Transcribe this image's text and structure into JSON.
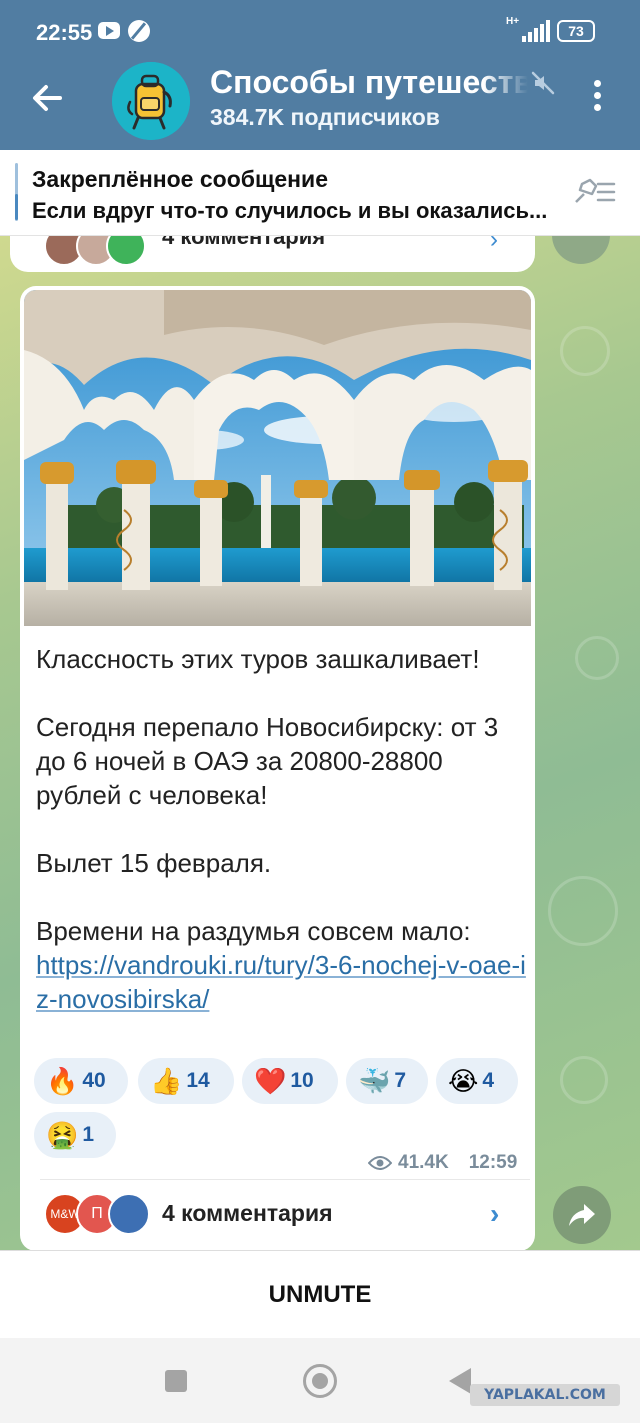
{
  "status_bar": {
    "time": "22:55",
    "network": "H+",
    "battery": "73"
  },
  "header": {
    "channel_title": "Способы путешествовать",
    "subscribers": "384.7K подписчиков",
    "muted": true,
    "colors": {
      "header_bg": "#517da2",
      "avatar_bg": "#1cb4c8"
    }
  },
  "pinned": {
    "title": "Закреплённое сообщение",
    "text": "Если вдруг что-то случилось и вы оказались..."
  },
  "previous_message": {
    "comments_label": "4 комментария"
  },
  "post": {
    "paragraphs": [
      "Классность этих туров зашкаливает!",
      "Сегодня перепало Новосибирску: от 3 до 6 ночей в ОАЭ за 20800-28800 рублей с человека!",
      "Вылет 15 февраля."
    ],
    "last_paragraph": "Времени на раздумья совсем мало:",
    "link": "https://vandrouki.ru/tury/3-6-nochej-v-oae-iz-novosibirska/",
    "reactions": [
      {
        "emoji": "🔥",
        "count": "40"
      },
      {
        "emoji": "👍",
        "count": "14"
      },
      {
        "emoji": "❤️",
        "count": "10"
      },
      {
        "emoji": "🐳",
        "count": "7"
      },
      {
        "emoji": "😭",
        "count": "4"
      },
      {
        "emoji": "🤮",
        "count": "1"
      }
    ],
    "views": "41.4K",
    "time": "12:59",
    "comments_label": "4 комментария",
    "comment_avatars": [
      {
        "label": "M&W",
        "color": "#d8431f"
      },
      {
        "label": "П",
        "color": "#e2564f"
      },
      {
        "label": "",
        "color": "#3d6fb3"
      }
    ]
  },
  "footer": {
    "unmute_label": "UNMUTE"
  },
  "watermark": "YAPLAKAL.COM"
}
